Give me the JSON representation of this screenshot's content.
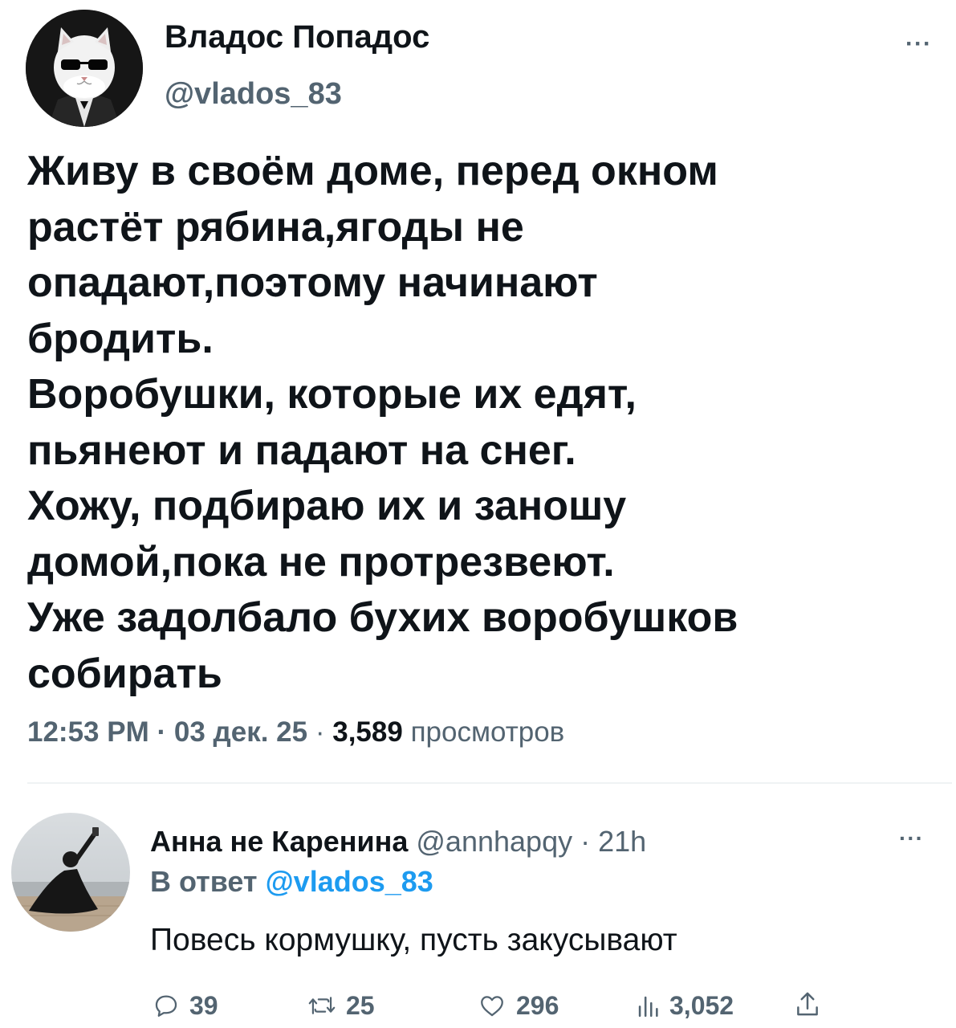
{
  "tweet": {
    "author_name": "Владос Попадос",
    "author_handle": "@vlados_83",
    "more_icon": "more-icon",
    "text_lines": [
      "Живу в своём доме, перед окном",
      "растёт рябина,ягоды не",
      "опадают,поэтому начинают",
      "бродить.",
      "Воробушки, которые их едят,",
      "пьянеют и падают на снег.",
      "Хожу, подбираю их и заношу",
      "домой,пока не протрезвеют.",
      "Уже задолбало бухих воробушков",
      "собирать"
    ],
    "time": "12:53 PM",
    "separator": "·",
    "date": "03 дек. 25",
    "views_count": "3,589",
    "views_label": "просмотров"
  },
  "reply": {
    "author_name": "Анна не Каренина",
    "author_handle": "@annhapqy",
    "separator": "·",
    "time": "21h",
    "in_reply_to_label": "В ответ",
    "in_reply_to_handle": "@vlados_83",
    "text": "Повесь кормушку, пусть закусывают",
    "actions": {
      "replies": "39",
      "retweets": "25",
      "likes": "296",
      "views": "3,052"
    }
  },
  "colors": {
    "text_primary": "#0f1419",
    "text_secondary": "#536471",
    "link": "#1d9bf0",
    "divider": "#eff3f4"
  }
}
